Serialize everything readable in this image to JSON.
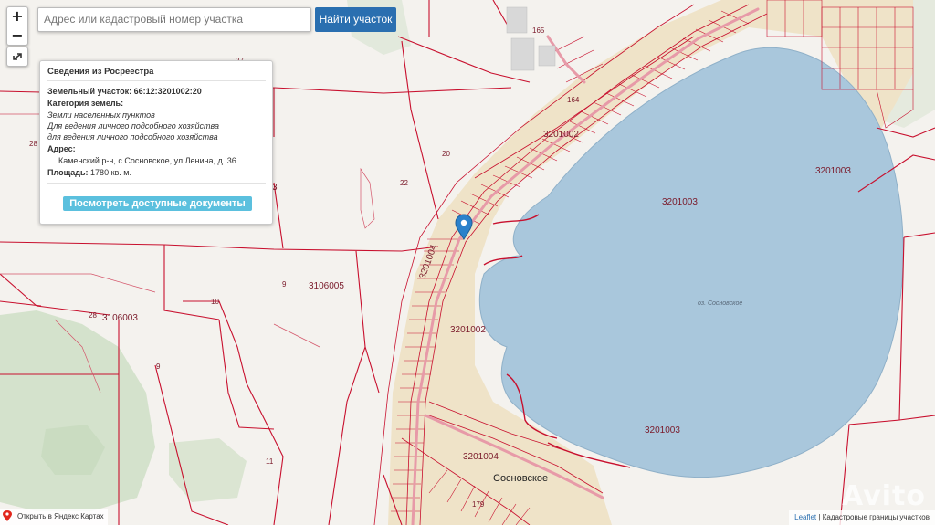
{
  "search": {
    "placeholder": "Адрес или кадастровый номер участка",
    "button_label": "Найти участок"
  },
  "controls": {
    "zoom_in": "+",
    "zoom_out": "−"
  },
  "popup": {
    "title": "Сведения из Росреестра",
    "parcel_label": "Земельный участок:",
    "parcel_number": "66:12:3201002:20",
    "category_label": "Категория земель:",
    "category_value": "Земли населенных пунктов",
    "use_line_1": "Для ведения личного подсобного хозяйства",
    "use_line_2": "для ведения личного подсобного хозяйства",
    "address_label": "Адрес:",
    "address_value": "Каменский р-н, с Сосновское, ул Ленина, д. 36",
    "area_label": "Площадь:",
    "area_value": "1780 кв. м.",
    "docs_button": "Посмотреть доступные документы"
  },
  "map_labels": {
    "quarter_3201002_a": "3201002",
    "quarter_3201002_b": "3201002",
    "quarter_3201003_a": "3201003",
    "quarter_3201003_b": "3201003",
    "quarter_3201003_c": "3201003",
    "quarter_3201004_a": "3201004",
    "quarter_3201004_b": "3201004",
    "quarter_3106005": "3106005",
    "quarter_3106003": "3106003",
    "parcel_27": "27",
    "parcel_28a": "28",
    "parcel_28b": "28",
    "parcel_20": "20",
    "parcel_22": "22",
    "parcel_9a": "9",
    "parcel_9b": "9",
    "parcel_10": "10",
    "parcel_11": "11",
    "parcel_165": "165",
    "parcel_164": "164",
    "parcel_179": "179",
    "parcel_3": "3",
    "village": "Сосновское",
    "lake": "оз. Сосновское"
  },
  "footer": {
    "yandex_link": "Открыть в Яндекс Картах",
    "leaflet_link": "Leaflet",
    "attribution": "Кадастровые границы участков",
    "watermark": "Avito"
  },
  "colors": {
    "water": "#a9c7dc",
    "boundary": "#c8102e",
    "land": "#f4f2ee",
    "forest": "#c9dcc0",
    "settlement": "#efe3c8",
    "marker": "#2a81cb",
    "button": "#2a6fb0",
    "docs_button": "#5bc0de"
  }
}
